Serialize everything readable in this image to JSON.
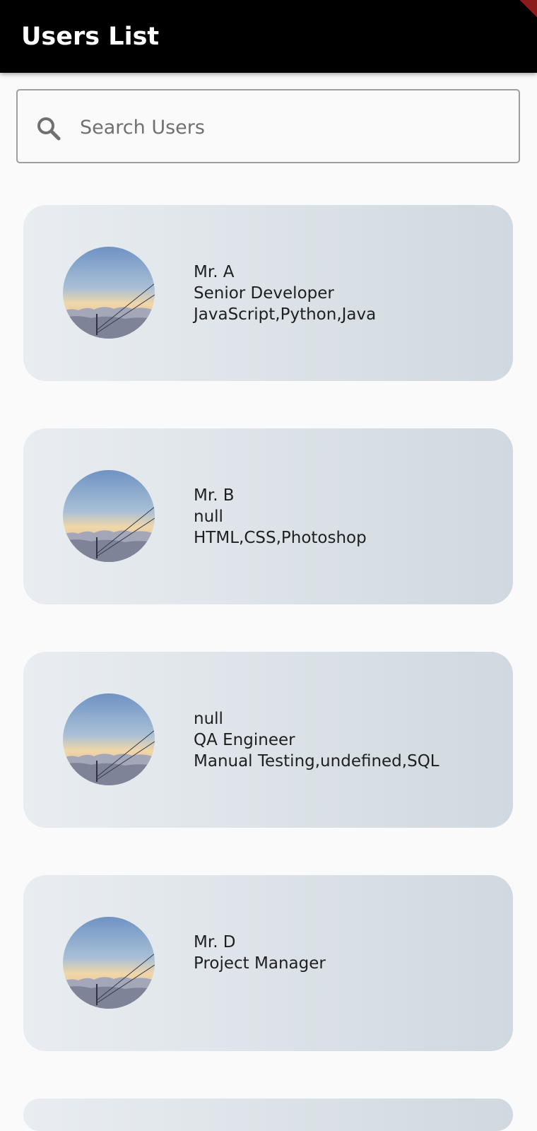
{
  "appbar": {
    "title": "Users List"
  },
  "search": {
    "placeholder": "Search Users",
    "icon": "search-icon"
  },
  "users": [
    {
      "name": "Mr. A",
      "role": "Senior Developer",
      "skills": "JavaScript,Python,Java"
    },
    {
      "name": "Mr. B",
      "role": "null",
      "skills": "HTML,CSS,Photoshop"
    },
    {
      "name": "null",
      "role": "QA Engineer",
      "skills": "Manual Testing,undefined,SQL"
    },
    {
      "name": "Mr. D",
      "role": "Project Manager",
      "skills": ""
    },
    {
      "name": "",
      "role": "",
      "skills": ""
    }
  ],
  "colors": {
    "appbar": "#000000",
    "background": "#fafafa",
    "card_gradient_start": "#e9edf1",
    "card_gradient_end": "#d0d9df",
    "debug_banner": "#8b1a1a"
  }
}
